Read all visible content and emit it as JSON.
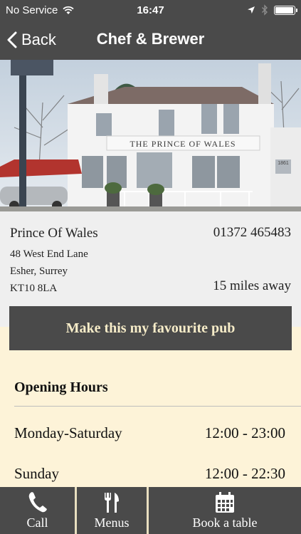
{
  "status_bar": {
    "carrier": "No Service",
    "time": "16:47",
    "battery_level": 0.95
  },
  "nav": {
    "back_label": "Back",
    "title": "Chef & Brewer"
  },
  "hero": {
    "pub_sign_text": "THE PRINCE OF WALES",
    "plaque_text": "1861"
  },
  "pub": {
    "name": "Prince Of Wales",
    "phone": "01372 465483",
    "address_lines": [
      "48 West End Lane",
      "Esher, Surrey",
      "KT10 8LA"
    ],
    "distance": "15 miles away"
  },
  "favourite_button": "Make this my favourite pub",
  "opening_hours": {
    "title": "Opening Hours",
    "rows": [
      {
        "days": "Monday-Saturday",
        "hours": "12:00 - 23:00"
      },
      {
        "days": "Sunday",
        "hours": "12:00 - 22:30"
      }
    ]
  },
  "tab_bar": {
    "items": [
      {
        "label": "Call",
        "icon": "phone-icon"
      },
      {
        "label": "Menus",
        "icon": "cutlery-icon"
      },
      {
        "label": "Book a table",
        "icon": "calendar-icon"
      }
    ]
  },
  "colors": {
    "bar": "#4a4a4a",
    "background": "#fdf3d8",
    "button_text": "#f6ecc8",
    "info_panel": "#efefef"
  }
}
